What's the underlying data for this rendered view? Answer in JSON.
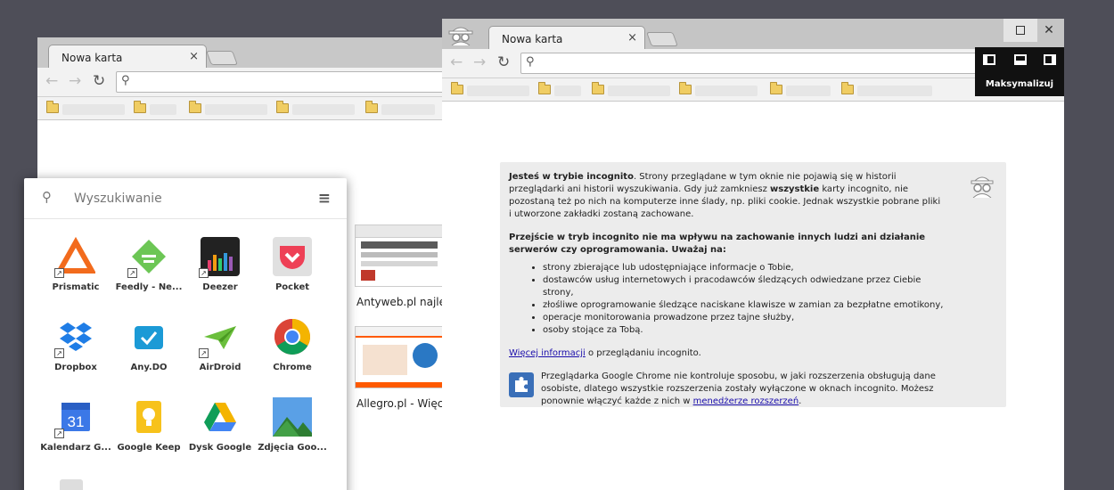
{
  "left_window": {
    "tab_title": "Nowa karta",
    "tab_close": "×"
  },
  "launcher": {
    "search_placeholder": "Wyszukiwanie",
    "apps": [
      {
        "name": "Prismatic",
        "color": "#f26b1d",
        "icon": "prismatic-icon"
      },
      {
        "name": "Feedly - Ne...",
        "color": "#6cc655",
        "icon": "feedly-icon"
      },
      {
        "name": "Deezer",
        "color": "#222222",
        "icon": "deezer-icon"
      },
      {
        "name": "Pocket",
        "color": "#ee4056",
        "icon": "pocket-icon"
      },
      {
        "name": "Dropbox",
        "color": "#1f7de6",
        "icon": "dropbox-icon"
      },
      {
        "name": "Any.DO",
        "color": "#1b9ad6",
        "icon": "anydo-icon"
      },
      {
        "name": "AirDroid",
        "color": "#6bbf3c",
        "icon": "airdroid-icon"
      },
      {
        "name": "Chrome",
        "color": "#db4437",
        "icon": "chrome-icon"
      },
      {
        "name": "Kalendarz G...",
        "color": "#3b78e7",
        "icon": "calendar-icon"
      },
      {
        "name": "Google Keep",
        "color": "#f7c21b",
        "icon": "keep-icon"
      },
      {
        "name": "Dysk Google",
        "color": "#1fa463",
        "icon": "drive-icon"
      },
      {
        "name": "Zdjęcia Goo...",
        "color": "#4a90d9",
        "icon": "photos-icon"
      }
    ],
    "calendar_day": "31"
  },
  "thumbnails": [
    {
      "caption": "Antyweb.pl najlep"
    },
    {
      "caption": "Allegro.pl - Więce"
    }
  ],
  "incognito_window": {
    "tab_title": "Nowa karta",
    "tab_close": "×",
    "close_button": "✕",
    "snap_tooltip": "Maksymalizuj",
    "para1_bold": "Jesteś w trybie incognito",
    "para1_a": ". Strony przeglądane w tym oknie nie pojawią się w historii przeglądarki ani historii wyszukiwania. Gdy już zamkniesz ",
    "para1_bold2": "wszystkie",
    "para1_b": " karty incognito, nie pozostaną też po nich na komputerze inne ślady, np. pliki cookie. Jednak wszystkie pobrane pliki i utworzone zakładki zostaną zachowane.",
    "para2_bold": "Przejście w tryb incognito nie ma wpływu na zachowanie innych ludzi ani działanie serwerów czy oprogramowania. Uważaj na:",
    "bullets": [
      "strony zbierające lub udostępniające informacje o Tobie,",
      "dostawców usług internetowych i pracodawców śledzących odwiedzane przez Ciebie strony,",
      "złośliwe oprogramowanie śledzące naciskane klawisze w zamian za bezpłatne emotikony,",
      "operacje monitorowania prowadzone przez tajne służby,",
      "osoby stojące za Tobą."
    ],
    "more_link": "Więcej informacji",
    "more_rest": " o przeglądaniu incognito.",
    "ext_text": "Przeglądarka Google Chrome nie kontroluje sposobu, w jaki rozszerzenia obsługują dane osobiste, dlatego wszystkie rozszerzenia zostały wyłączone w oknach incognito. Możesz ponownie włączyć każde z nich w ",
    "ext_link": "menedżerze rozszerzeń",
    "ext_end": "."
  },
  "colors": {
    "desktop": "#4e4e58",
    "folder": "#f0cd63",
    "link": "#1a0dab"
  }
}
